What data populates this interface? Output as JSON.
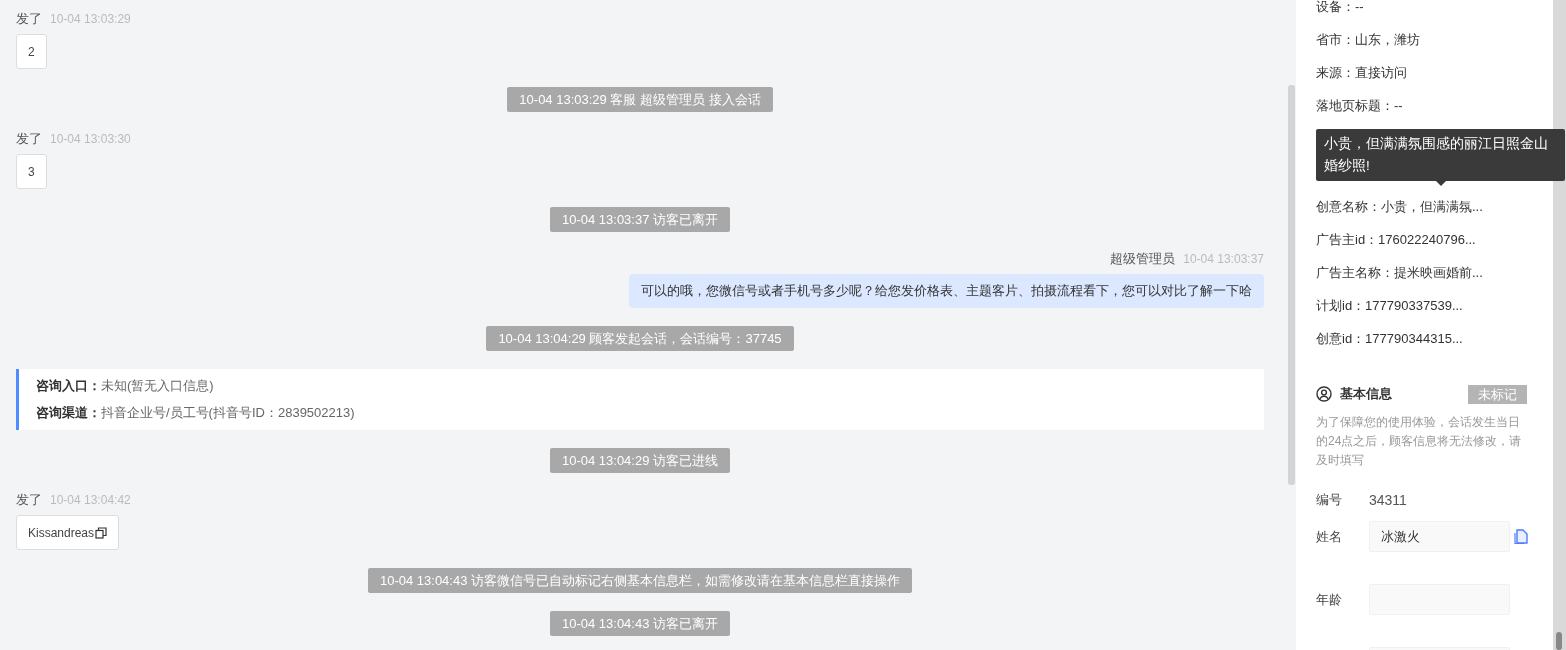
{
  "chat": {
    "items": [
      {
        "kind": "visitor",
        "sender": "发了",
        "time": "10-04 13:03:29",
        "text": "2",
        "copyable": false
      },
      {
        "kind": "system",
        "text": "10-04 13:03:29 客服 超级管理员 接入会话"
      },
      {
        "kind": "visitor",
        "sender": "发了",
        "time": "10-04 13:03:30",
        "text": "3",
        "copyable": false
      },
      {
        "kind": "system",
        "text": "10-04 13:03:37 访客已离开"
      },
      {
        "kind": "agent",
        "sender": "超级管理员",
        "time": "10-04 13:03:37",
        "text": "可以的哦，您微信号或者手机号多少呢？给您发价格表、主题客片、拍摄流程看下，您可以对比了解一下哈"
      },
      {
        "kind": "system",
        "text": "10-04 13:04:29 顾客发起会话，会话编号：37745"
      },
      {
        "kind": "info",
        "lines": [
          {
            "label": "咨询入口：",
            "value": "未知(暂无入口信息)"
          },
          {
            "label": "咨询渠道：",
            "value": "抖音企业号/员工号(抖音号ID：2839502213)"
          }
        ]
      },
      {
        "kind": "system",
        "text": "10-04 13:04:29 访客已进线"
      },
      {
        "kind": "visitor",
        "sender": "发了",
        "time": "10-04 13:04:42",
        "text": "Kissandreas",
        "copyable": true
      },
      {
        "kind": "system",
        "text": "10-04 13:04:43 访客微信号已自动标记右侧基本信息栏，如需修改请在基本信息栏直接操作"
      },
      {
        "kind": "system",
        "text": "10-04 13:04:43 访客已离开"
      }
    ]
  },
  "visitor_details": {
    "rows": [
      {
        "text": "设备：--"
      },
      {
        "text": "省市：山东，潍坊"
      },
      {
        "text": "来源：直接访问"
      },
      {
        "text": "落地页标题：--"
      },
      {
        "kind": "tooltip",
        "text": "小贵，但满满氛围感的丽江日照金山婚纱照!"
      },
      {
        "text": "创意名称：小贵，但满满氛..."
      },
      {
        "text": "广告主id：176022240796..."
      },
      {
        "text": "广告主名称：提米映画婚前..."
      },
      {
        "text": "计划id：177790337539..."
      },
      {
        "text": "创意id：177790344315..."
      }
    ]
  },
  "basic_info": {
    "title": "基本信息",
    "tag": "未标记",
    "notice": "为了保障您的使用体验，会话发生当日的24点之后，顾客信息将无法修改，请及时填写",
    "fields": [
      {
        "kind": "text",
        "label": "编号",
        "value": "34311",
        "copyable": false
      },
      {
        "kind": "input",
        "label": "姓名",
        "value": "冰激火",
        "copyable": true
      },
      {
        "kind": "input",
        "label": "年龄",
        "copyable": false
      },
      {
        "kind": "input"
      }
    ]
  }
}
